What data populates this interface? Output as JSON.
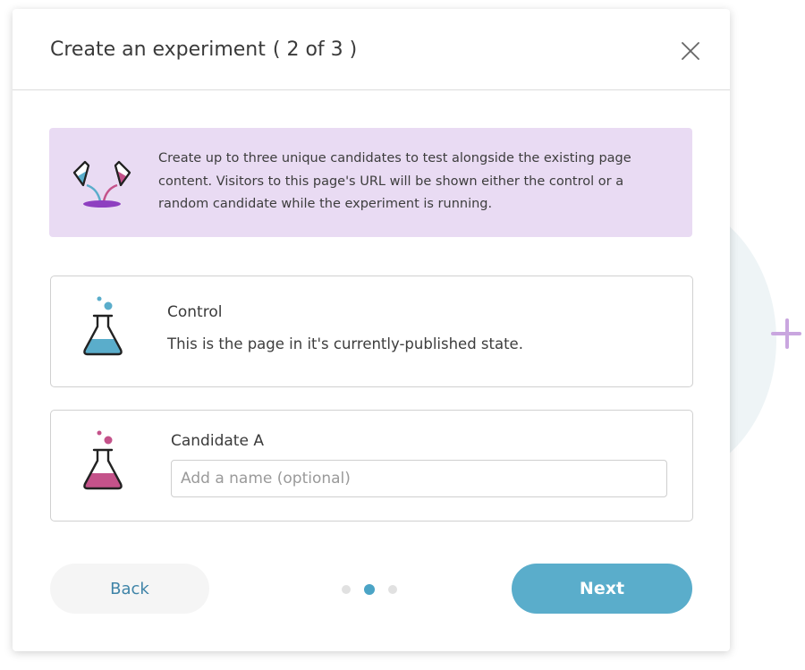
{
  "modal": {
    "title": "Create an experiment",
    "step": "( 2 of 3 )"
  },
  "banner": {
    "text": "Create up to three unique candidates to test alongside the existing page content. Visitors to this page's URL will be shown either the control or a random candidate while the experiment is running."
  },
  "control": {
    "title": "Control",
    "description": "This is the page in it's currently-published state."
  },
  "candidate": {
    "title": "Candidate A",
    "name_value": "",
    "name_placeholder": "Add a name (optional)"
  },
  "footer": {
    "back_label": "Back",
    "next_label": "Next",
    "steps_total": 3,
    "current_step": 2
  },
  "colors": {
    "control_accent": "#5aadcb",
    "candidate_accent": "#c4528a",
    "banner_bg": "#e9dbf3",
    "primary_button": "#5aadcb",
    "add_icon": "#c9a6df"
  },
  "icons": {
    "close": "close-icon",
    "banner": "pouring-flasks-icon",
    "control": "flask-blue-icon",
    "candidate": "flask-pink-icon",
    "add": "plus-icon"
  }
}
